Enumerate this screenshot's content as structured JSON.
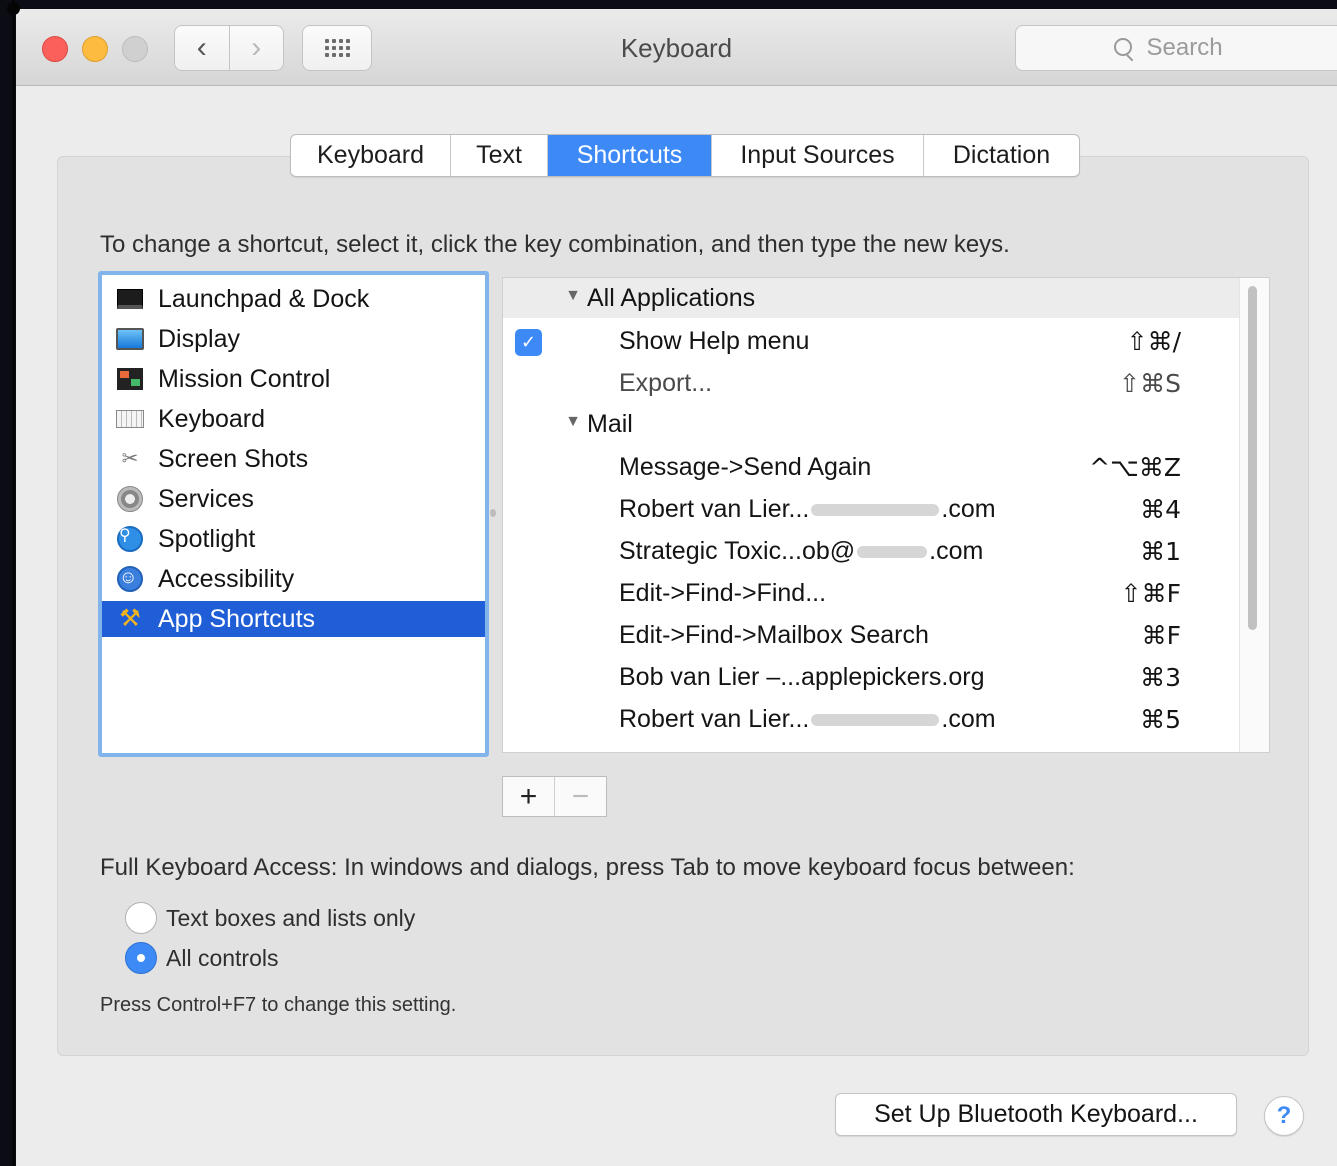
{
  "window": {
    "title": "Keyboard"
  },
  "search": {
    "placeholder": "Search"
  },
  "tabs": [
    {
      "label": "Keyboard"
    },
    {
      "label": "Text"
    },
    {
      "label": "Shortcuts",
      "active": true
    },
    {
      "label": "Input Sources"
    },
    {
      "label": "Dictation"
    }
  ],
  "instructions": "To change a shortcut, select it, click the key combination, and then type the new keys.",
  "categories": [
    {
      "label": "Launchpad & Dock",
      "icon": "launchpad-dock-icon"
    },
    {
      "label": "Display",
      "icon": "display-icon"
    },
    {
      "label": "Mission Control",
      "icon": "mission-control-icon"
    },
    {
      "label": "Keyboard",
      "icon": "keyboard-icon"
    },
    {
      "label": "Screen Shots",
      "icon": "screen-shots-icon"
    },
    {
      "label": "Services",
      "icon": "services-gear-icon"
    },
    {
      "label": "Spotlight",
      "icon": "spotlight-icon"
    },
    {
      "label": "Accessibility",
      "icon": "accessibility-icon"
    },
    {
      "label": "App Shortcuts",
      "icon": "app-shortcuts-icon",
      "selected": true
    }
  ],
  "shortcuts": {
    "groups": [
      {
        "name": "All Applications",
        "items": [
          {
            "action": "Show Help menu",
            "keys": "⇧⌘/",
            "enabled": true
          },
          {
            "action": "Export...",
            "keys": "⇧⌘S",
            "dim": true
          }
        ]
      },
      {
        "name": "Mail",
        "items": [
          {
            "action": "Message->Send Again",
            "keys": "^⌥⌘Z"
          },
          {
            "action": "Robert van Lier...",
            "redacted": ".com",
            "keys": "⌘4"
          },
          {
            "action": "Strategic Toxic...ob@",
            "redacted": ".com",
            "keys": "⌘1"
          },
          {
            "action": "Edit->Find->Find...",
            "keys": "⇧⌘F"
          },
          {
            "action": "Edit->Find->Mailbox Search",
            "keys": "⌘F"
          },
          {
            "action": "Bob van Lier –...applepickers.org",
            "keys": "⌘3"
          },
          {
            "action": "Robert van Lier...",
            "redacted": ".com",
            "keys": "⌘5"
          }
        ]
      }
    ]
  },
  "buttons": {
    "add": "+",
    "remove": "−",
    "bluetooth": "Set Up Bluetooth Keyboard...",
    "help": "?"
  },
  "full_keyboard_access": {
    "label": "Full Keyboard Access: In windows and dialogs, press Tab to move keyboard focus between:",
    "options": [
      {
        "label": "Text boxes and lists only",
        "selected": false
      },
      {
        "label": "All controls",
        "selected": true
      }
    ],
    "hint": "Press Control+F7 to change this setting."
  },
  "colors": {
    "accent": "#3d8af7",
    "selection": "#1f5ed6",
    "focus_ring": "#82b4ec"
  }
}
